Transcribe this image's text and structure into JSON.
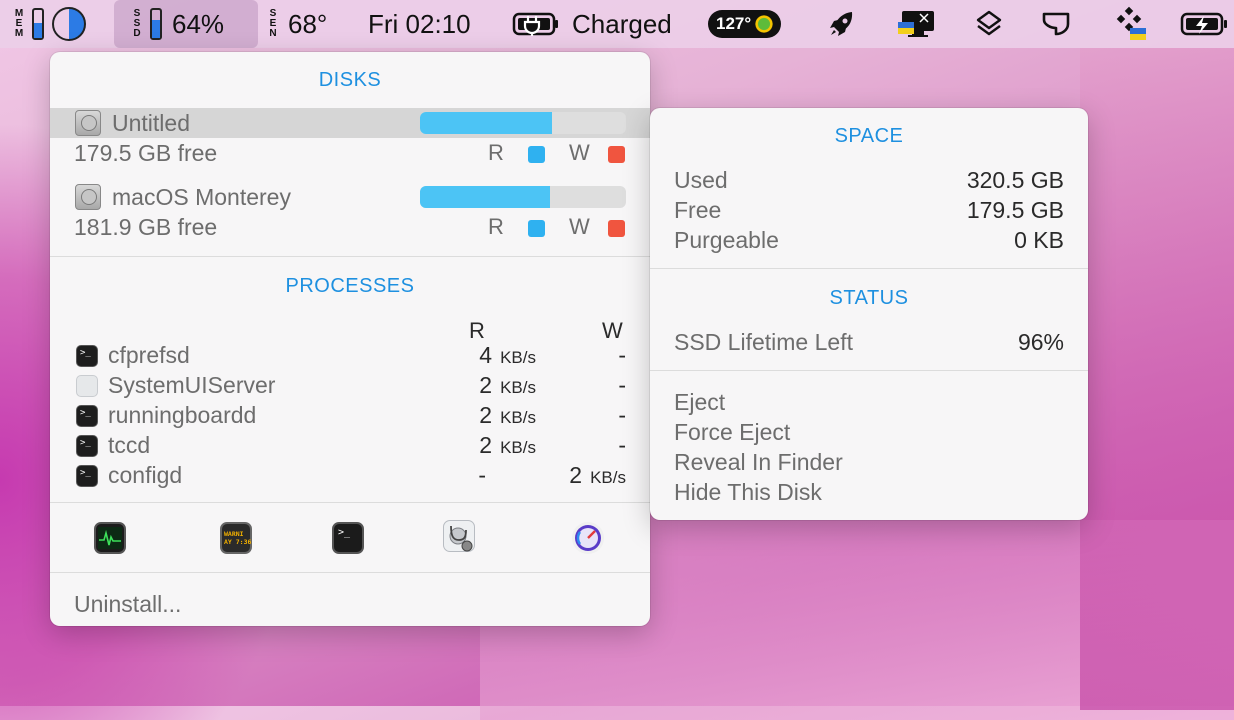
{
  "menubar": {
    "mem_label": "MEM",
    "ssd_label": "SSD",
    "ssd_percent": "64%",
    "sen_label": "SEN",
    "temperature": "68°",
    "datetime": "Fri 02:10",
    "battery_status": "Charged",
    "cpu_temp_badge": "127°",
    "mem_fill": 0.55,
    "ssd_fill": 0.64
  },
  "disks": {
    "title": "DISKS",
    "items": [
      {
        "name": "Untitled",
        "free": "179.5 GB free",
        "usage": 0.64,
        "read_label": "R",
        "write_label": "W"
      },
      {
        "name": "macOS Monterey",
        "free": "181.9 GB free",
        "usage": 0.63,
        "read_label": "R",
        "write_label": "W"
      }
    ]
  },
  "processes": {
    "title": "PROCESSES",
    "col_r": "R",
    "col_w": "W",
    "rows": [
      {
        "name": "cfprefsd",
        "r_num": "4",
        "r_unit": "KB/s",
        "w_num": "-",
        "w_unit": ""
      },
      {
        "name": "SystemUIServer",
        "r_num": "2",
        "r_unit": "KB/s",
        "w_num": "-",
        "w_unit": ""
      },
      {
        "name": "runningboardd",
        "r_num": "2",
        "r_unit": "KB/s",
        "w_num": "-",
        "w_unit": ""
      },
      {
        "name": "tccd",
        "r_num": "2",
        "r_unit": "KB/s",
        "w_num": "-",
        "w_unit": ""
      },
      {
        "name": "configd",
        "r_num": "-",
        "r_unit": "",
        "w_num": "2",
        "w_unit": "KB/s"
      }
    ]
  },
  "shortcuts": {
    "console_text": "WARNI\nAY 7:36",
    "terminal_prompt": ">_"
  },
  "footer": {
    "uninstall": "Uninstall..."
  },
  "space": {
    "title": "SPACE",
    "used_label": "Used",
    "used_value": "320.5 GB",
    "free_label": "Free",
    "free_value": "179.5 GB",
    "purgeable_label": "Purgeable",
    "purgeable_value": "0 KB"
  },
  "status": {
    "title": "STATUS",
    "lifetime_label": "SSD Lifetime Left",
    "lifetime_value": "96%"
  },
  "actions": {
    "eject": "Eject",
    "force_eject": "Force Eject",
    "reveal": "Reveal In Finder",
    "hide": "Hide This Disk"
  },
  "colors": {
    "accent": "#1e90e0",
    "read_indicator": "#2fb1f0",
    "write_indicator": "#f0553f",
    "usage_fill": "#4cc4f5"
  }
}
